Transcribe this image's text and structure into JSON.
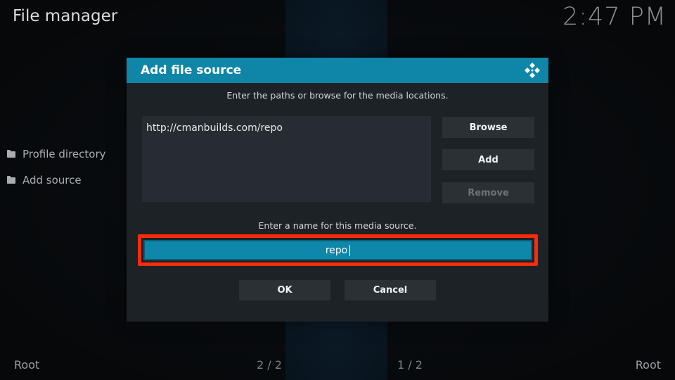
{
  "header": {
    "title": "File manager",
    "clock": "2:47 PM"
  },
  "sidebar": {
    "items": [
      {
        "label": "Profile directory",
        "icon": "folder-icon"
      },
      {
        "label": "Add source",
        "icon": "folder-icon"
      }
    ]
  },
  "footer": {
    "left": "Root",
    "page_left": "2 / 2",
    "page_right": "1 / 2",
    "right": "Root"
  },
  "dialog": {
    "title": "Add file source",
    "logo_icon": "kodi-logo-icon",
    "paths_instruction": "Enter the paths or browse for the media locations.",
    "path_value": "http://cmanbuilds.com/repo",
    "browse_label": "Browse",
    "add_label": "Add",
    "remove_label": "Remove",
    "name_instruction": "Enter a name for this media source.",
    "name_value": "repo",
    "ok_label": "OK",
    "cancel_label": "Cancel"
  },
  "colors": {
    "accent": "#0f86a8",
    "highlight": "#ff2a0a",
    "dialog_bg": "#1d2226",
    "button_bg": "#2a3034"
  }
}
